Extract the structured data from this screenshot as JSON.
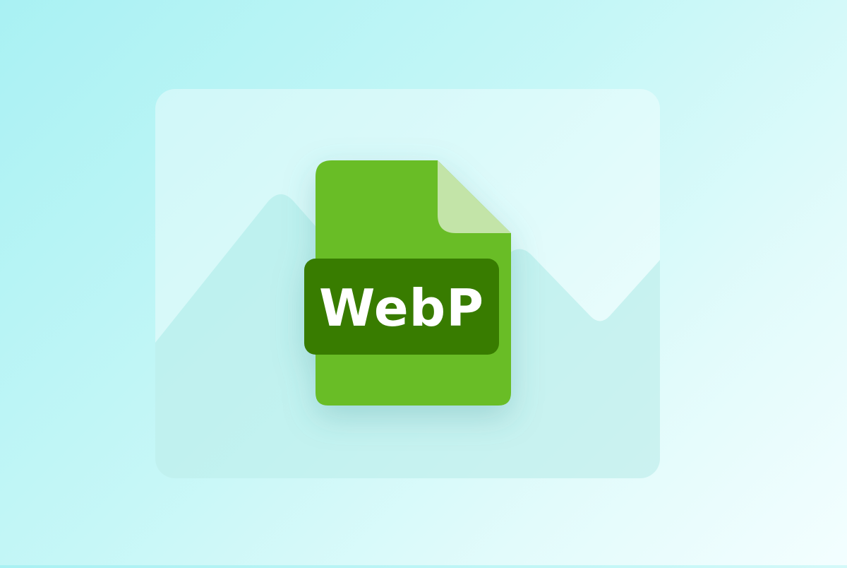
{
  "file_badge": {
    "label": "WebP"
  },
  "icons": {
    "background": "image-placeholder-icon",
    "foreground": "file-icon"
  },
  "colors": {
    "background_start": "#a9f1f3",
    "background_end": "#f3feff",
    "file_body": "#69bd26",
    "file_fold": "#c3e4a8",
    "label_bg": "#387c00",
    "label_text": "#ffffff"
  }
}
